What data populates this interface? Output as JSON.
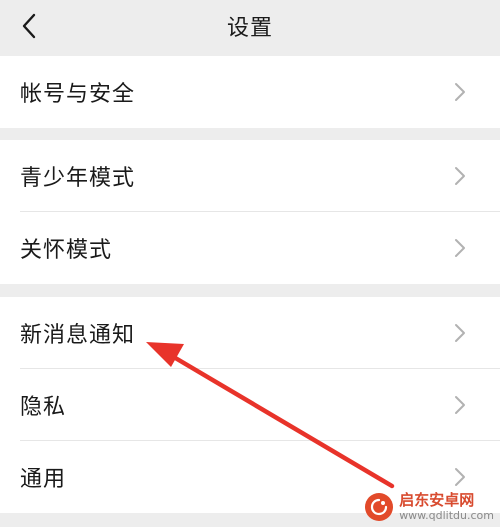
{
  "header": {
    "title": "设置",
    "back_icon": "chevron-left-icon"
  },
  "groups": [
    {
      "items": [
        {
          "label": "帐号与安全"
        }
      ]
    },
    {
      "items": [
        {
          "label": "青少年模式"
        },
        {
          "label": "关怀模式"
        }
      ]
    },
    {
      "items": [
        {
          "label": "新消息通知"
        },
        {
          "label": "隐私"
        },
        {
          "label": "通用"
        }
      ]
    }
  ],
  "annotation": {
    "arrow_color": "#e8332a"
  },
  "watermark": {
    "name": "启东安卓网",
    "url": "www.qdlitdu.com",
    "brand_color": "#d84b2f"
  }
}
